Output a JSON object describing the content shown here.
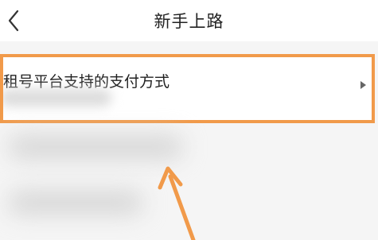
{
  "header": {
    "title": "新手上路",
    "back_icon": "chevron-left-icon"
  },
  "list": {
    "items": [
      {
        "label": "租号平台支持的支付方式",
        "chevron_icon": "triangle-right-icon"
      }
    ]
  },
  "annotation": {
    "highlight_color": "#f19a4a",
    "arrow_color": "#f19a4a"
  }
}
